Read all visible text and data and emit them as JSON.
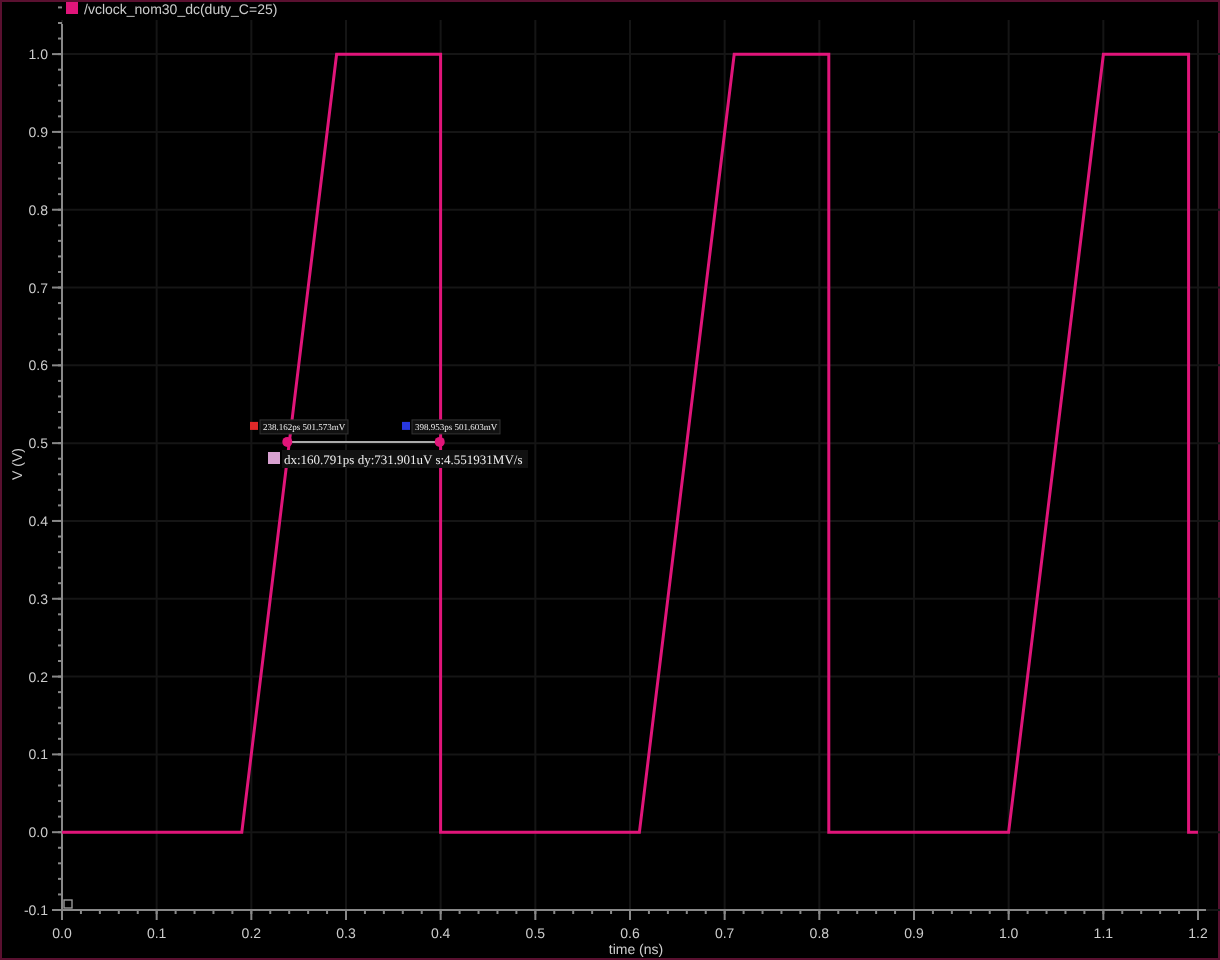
{
  "chart_data": {
    "type": "line",
    "xlabel": "time (ns)",
    "ylabel": "V (V)",
    "grid": true,
    "x": [
      0.0,
      0.19,
      0.29,
      0.4,
      0.4,
      0.61,
      0.71,
      0.81,
      0.81,
      1.0,
      1.1,
      1.19,
      1.19,
      1.2
    ],
    "series": [
      {
        "name": "/vclock_nom30_dc(duty_C=25)",
        "color": "#e0157a",
        "values": [
          0,
          0,
          1,
          1,
          0,
          0,
          1,
          1,
          0,
          0,
          1,
          1,
          0,
          0
        ]
      }
    ],
    "xlim": [
      0,
      1.2
    ],
    "ylim": [
      -0.1,
      1.05
    ],
    "xticks": [
      {
        "value": 0,
        "label": "0.0"
      },
      {
        "value": 0.1,
        "label": "0.1"
      },
      {
        "value": 0.2,
        "label": "0.2"
      },
      {
        "value": 0.3,
        "label": "0.3"
      },
      {
        "value": 0.4,
        "label": "0.4"
      },
      {
        "value": 0.5,
        "label": "0.5"
      },
      {
        "value": 0.6,
        "label": "0.6"
      },
      {
        "value": 0.7,
        "label": "0.7"
      },
      {
        "value": 0.8,
        "label": "0.8"
      },
      {
        "value": 0.9,
        "label": "0.9"
      },
      {
        "value": 1,
        "label": "1.0"
      },
      {
        "value": 1.1,
        "label": "1.1"
      },
      {
        "value": 1.2,
        "label": "1.2"
      }
    ],
    "yticks": [
      {
        "value": -0.1,
        "label": "-0.1"
      },
      {
        "value": 0,
        "label": "0.0"
      },
      {
        "value": 0.1,
        "label": "0.1"
      },
      {
        "value": 0.2,
        "label": "0.2"
      },
      {
        "value": 0.3,
        "label": "0.3"
      },
      {
        "value": 0.4,
        "label": "0.4"
      },
      {
        "value": 0.5,
        "label": "0.5"
      },
      {
        "value": 0.6,
        "label": "0.6"
      },
      {
        "value": 0.7,
        "label": "0.7"
      },
      {
        "value": 0.8,
        "label": "0.8"
      },
      {
        "value": 0.9,
        "label": "0.9"
      },
      {
        "value": 1,
        "label": "1.0"
      }
    ],
    "annotations": [
      {
        "x": 0.238,
        "y": 0.5016,
        "text": "238.162ps 501.573mV"
      },
      {
        "x": 0.399,
        "y": 0.5016,
        "text": "398.953ps 501.603mV"
      }
    ]
  },
  "cursors": [
    {
      "color": "#e02828"
    },
    {
      "color": "#2838e0"
    }
  ],
  "delta": {
    "label": "dx:160.791ps dy:731.901uV s:4.551931MV/s",
    "color": "#d8a0d0"
  }
}
